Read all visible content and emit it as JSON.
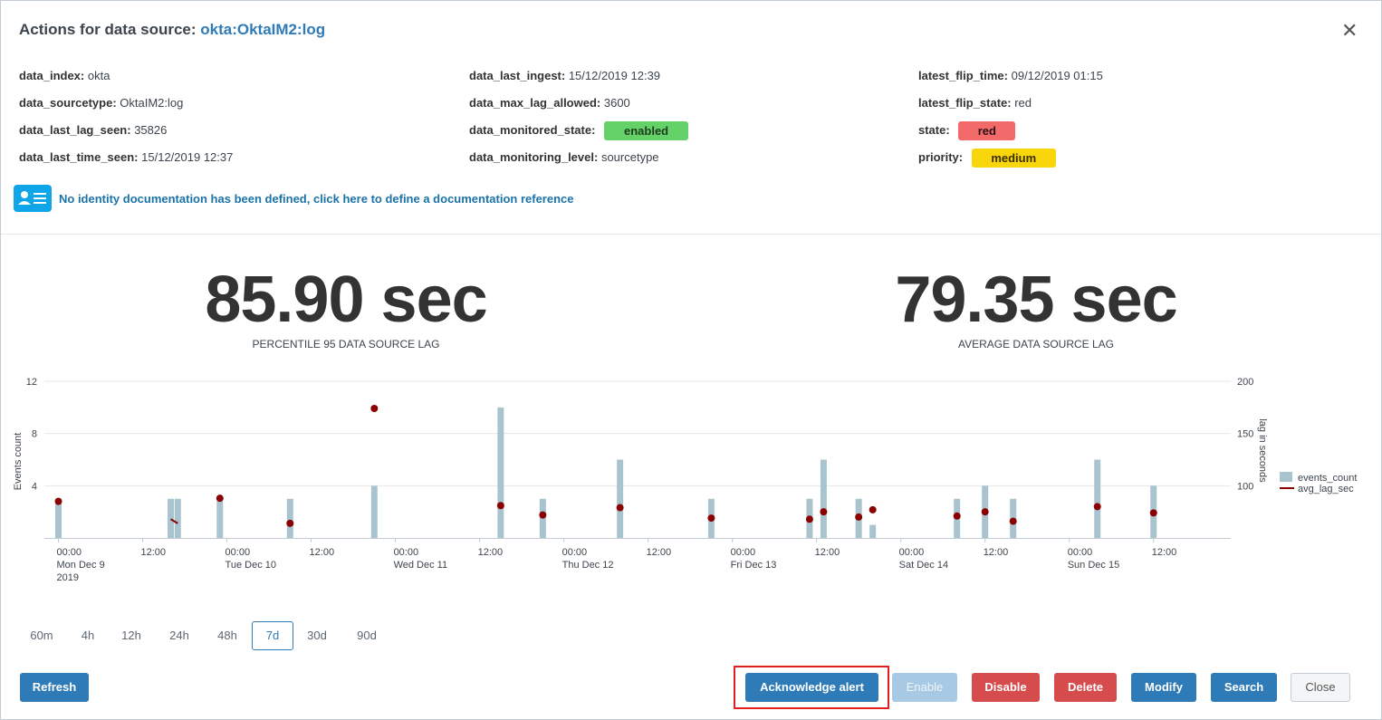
{
  "header": {
    "title_prefix": "Actions for data source: ",
    "title_source": "okta:OktaIM2:log"
  },
  "fields": [
    {
      "id": "data_index",
      "label": "data_index:",
      "value": "okta",
      "col": 0,
      "row": 0
    },
    {
      "id": "data_sourcetype",
      "label": "data_sourcetype:",
      "value": "OktaIM2:log",
      "col": 0,
      "row": 1
    },
    {
      "id": "data_last_lag_seen",
      "label": "data_last_lag_seen:",
      "value": "35826",
      "col": 0,
      "row": 2
    },
    {
      "id": "data_last_time_seen",
      "label": "data_last_time_seen:",
      "value": "15/12/2019 12:37",
      "col": 0,
      "row": 3
    },
    {
      "id": "data_last_ingest",
      "label": "data_last_ingest:",
      "value": "15/12/2019 12:39",
      "col": 1,
      "row": 0
    },
    {
      "id": "data_max_lag_allowed",
      "label": "data_max_lag_allowed:",
      "value": "3600",
      "col": 1,
      "row": 1
    },
    {
      "id": "data_monitored_state",
      "label": "data_monitored_state:",
      "value": "enabled",
      "col": 1,
      "row": 2,
      "badge": "green"
    },
    {
      "id": "data_monitoring_level",
      "label": "data_monitoring_level:",
      "value": "sourcetype",
      "col": 1,
      "row": 3
    },
    {
      "id": "latest_flip_time",
      "label": "latest_flip_time:",
      "value": "09/12/2019 01:15",
      "col": 2,
      "row": 0
    },
    {
      "id": "latest_flip_state",
      "label": "latest_flip_state:",
      "value": "red",
      "col": 2,
      "row": 1
    },
    {
      "id": "state",
      "label": "state:",
      "value": "red",
      "col": 2,
      "row": 2,
      "badge": "red"
    },
    {
      "id": "priority",
      "label": "priority:",
      "value": "medium",
      "col": 2,
      "row": 3,
      "badge": "yellow"
    }
  ],
  "documentation": {
    "icon": "id-card-icon",
    "link_text": "No identity documentation has been defined, click here to define a documentation reference"
  },
  "stats": {
    "p95": {
      "value": "85.90 sec",
      "label": "PERCENTILE 95 DATA SOURCE LAG"
    },
    "avg": {
      "value": "79.35 sec",
      "label": "AVERAGE DATA SOURCE LAG"
    }
  },
  "chart_data": {
    "type": "bar+scatter",
    "y_left_label": "Events count",
    "y_right_label": "lag in seconds",
    "y_left_ticks": [
      "4",
      "8",
      "12"
    ],
    "y_right_ticks": [
      "100",
      "150",
      "200"
    ],
    "y_left_range": [
      0,
      12
    ],
    "y_right_range": [
      50,
      200
    ],
    "x_ticks": [
      {
        "t": 0,
        "line1": "00:00",
        "line2": "Mon Dec 9",
        "line3": "2019"
      },
      {
        "t": 12,
        "line1": "12:00"
      },
      {
        "t": 24,
        "line1": "00:00",
        "line2": "Tue Dec 10"
      },
      {
        "t": 36,
        "line1": "12:00"
      },
      {
        "t": 48,
        "line1": "00:00",
        "line2": "Wed Dec 11"
      },
      {
        "t": 60,
        "line1": "12:00"
      },
      {
        "t": 72,
        "line1": "00:00",
        "line2": "Thu Dec 12"
      },
      {
        "t": 84,
        "line1": "12:00"
      },
      {
        "t": 96,
        "line1": "00:00",
        "line2": "Fri Dec 13"
      },
      {
        "t": 108,
        "line1": "12:00"
      },
      {
        "t": 120,
        "line1": "00:00",
        "line2": "Sat Dec 14"
      },
      {
        "t": 132,
        "line1": "12:00"
      },
      {
        "t": 144,
        "line1": "00:00",
        "line2": "Sun Dec 15"
      },
      {
        "t": 156,
        "line1": "12:00"
      }
    ],
    "t_range": [
      -2,
      167
    ],
    "grid": true,
    "legend_position": "right",
    "series": [
      {
        "name": "events_count",
        "kind": "bar",
        "color": "#a9c4cf",
        "points": [
          [
            0,
            3
          ],
          [
            16,
            3
          ],
          [
            17,
            3
          ],
          [
            23,
            3
          ],
          [
            33,
            3
          ],
          [
            45,
            4
          ],
          [
            63,
            10
          ],
          [
            69,
            3
          ],
          [
            80,
            6
          ],
          [
            93,
            3
          ],
          [
            107,
            3
          ],
          [
            109,
            6
          ],
          [
            114,
            3
          ],
          [
            116,
            1
          ],
          [
            128,
            3
          ],
          [
            132,
            4
          ],
          [
            136,
            3
          ],
          [
            148,
            6
          ],
          [
            156,
            4
          ]
        ]
      },
      {
        "name": "avg_lag_sec",
        "kind": "point",
        "color": "#8b0000",
        "points": [
          [
            0,
            85
          ],
          [
            23,
            88
          ],
          [
            33,
            64
          ],
          [
            45,
            174
          ],
          [
            63,
            81
          ],
          [
            69,
            72
          ],
          [
            80,
            79
          ],
          [
            93,
            69
          ],
          [
            107,
            68
          ],
          [
            109,
            75
          ],
          [
            114,
            70
          ],
          [
            116,
            77
          ],
          [
            128,
            71
          ],
          [
            132,
            75
          ],
          [
            136,
            66
          ],
          [
            148,
            80
          ],
          [
            156,
            74
          ]
        ],
        "segments": [
          [
            [
              16,
              68
            ],
            [
              17,
              64
            ]
          ]
        ]
      }
    ]
  },
  "time_ranges": {
    "items": [
      "60m",
      "4h",
      "12h",
      "24h",
      "48h",
      "7d",
      "30d",
      "90d"
    ],
    "selected": "7d"
  },
  "buttons": {
    "refresh": "Refresh",
    "acknowledge": "Acknowledge alert",
    "enable": "Enable",
    "disable": "Disable",
    "delete": "Delete",
    "modify": "Modify",
    "search": "Search",
    "close": "Close"
  },
  "colors": {
    "accent": "#2e7bb8",
    "danger": "#d64b4b",
    "badge_green": "#65d169",
    "badge_red": "#f26a6a",
    "badge_yellow": "#f8d60b",
    "highlight": "#e32020"
  }
}
